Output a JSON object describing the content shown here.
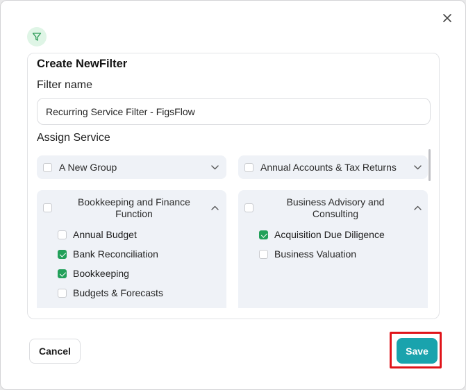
{
  "dialog": {
    "title": "Create NewFilter",
    "filter_name_label": "Filter name",
    "filter_name_value": "Recurring Service Filter - FigsFlow",
    "assign_service_label": "Assign Service"
  },
  "groups": [
    {
      "title": "A New Group",
      "checked": false,
      "expanded": false,
      "items": []
    },
    {
      "title": "Annual Accounts & Tax Returns",
      "checked": false,
      "expanded": false,
      "items": []
    },
    {
      "title_line1": "Bookkeeping and Finance",
      "title_line2": "Function",
      "checked": false,
      "expanded": true,
      "items": [
        {
          "label": "Annual Budget",
          "checked": false
        },
        {
          "label": "Bank Reconciliation",
          "checked": true
        },
        {
          "label": "Bookkeeping",
          "checked": true
        },
        {
          "label": "Budgets & Forecasts",
          "checked": false
        }
      ]
    },
    {
      "title_line1": "Business Advisory and",
      "title_line2": "Consulting",
      "checked": false,
      "expanded": true,
      "items": [
        {
          "label": "Acquisition Due Diligence",
          "checked": true
        },
        {
          "label": "Business Valuation",
          "checked": false
        }
      ]
    }
  ],
  "footer": {
    "cancel_label": "Cancel",
    "save_label": "Save"
  },
  "colors": {
    "accent": "#1aa3ad",
    "checkbox_checked": "#22a05a",
    "highlight": "#e0141a",
    "card_bg": "#eff2f7"
  },
  "icons": {
    "close": "close-icon",
    "filter": "filter-icon",
    "chevron_down": "chevron-down-icon",
    "chevron_up": "chevron-up-icon"
  }
}
